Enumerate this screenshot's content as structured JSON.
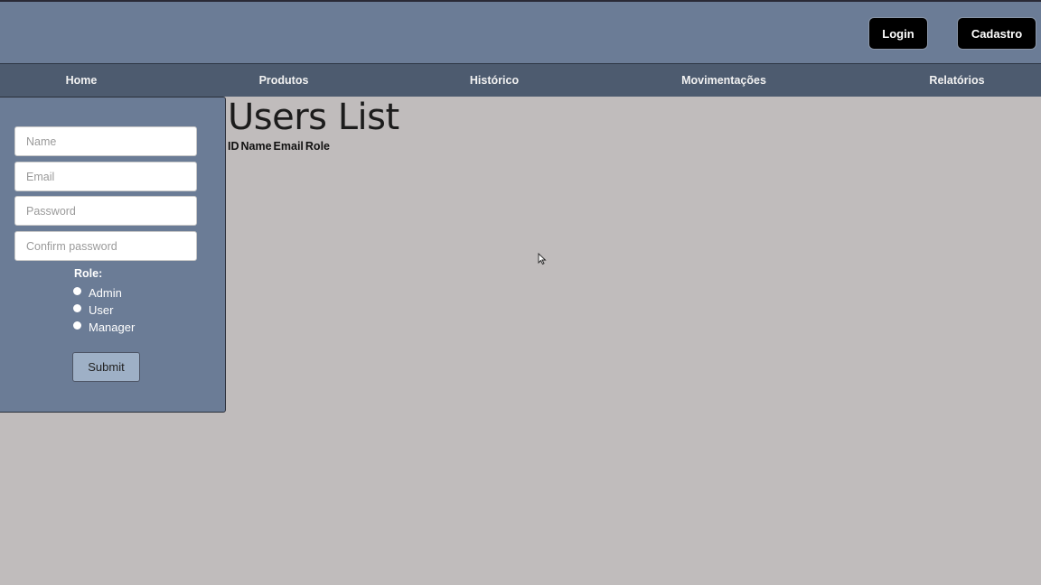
{
  "header": {
    "login_label": "Login",
    "register_label": "Cadastro"
  },
  "nav": {
    "items": [
      {
        "label": "Home"
      },
      {
        "label": "Produtos"
      },
      {
        "label": "Histórico"
      },
      {
        "label": "Movimentações"
      },
      {
        "label": "Relatórios"
      }
    ]
  },
  "form": {
    "name_placeholder": "Name",
    "email_placeholder": "Email",
    "password_placeholder": "Password",
    "confirm_placeholder": "Confirm password",
    "role_label": "Role:",
    "roles": [
      {
        "label": "Admin"
      },
      {
        "label": "User"
      },
      {
        "label": "Manager"
      }
    ],
    "submit_label": "Submit"
  },
  "main": {
    "title": "Users List",
    "columns": [
      "ID",
      "Name",
      "Email",
      "Role"
    ]
  },
  "colors": {
    "topbar": "#6b7c96",
    "navbar": "#4d5b6f",
    "background": "#c0bcbc",
    "auth_button": "#000000",
    "submit_button": "#9eb0c6"
  }
}
